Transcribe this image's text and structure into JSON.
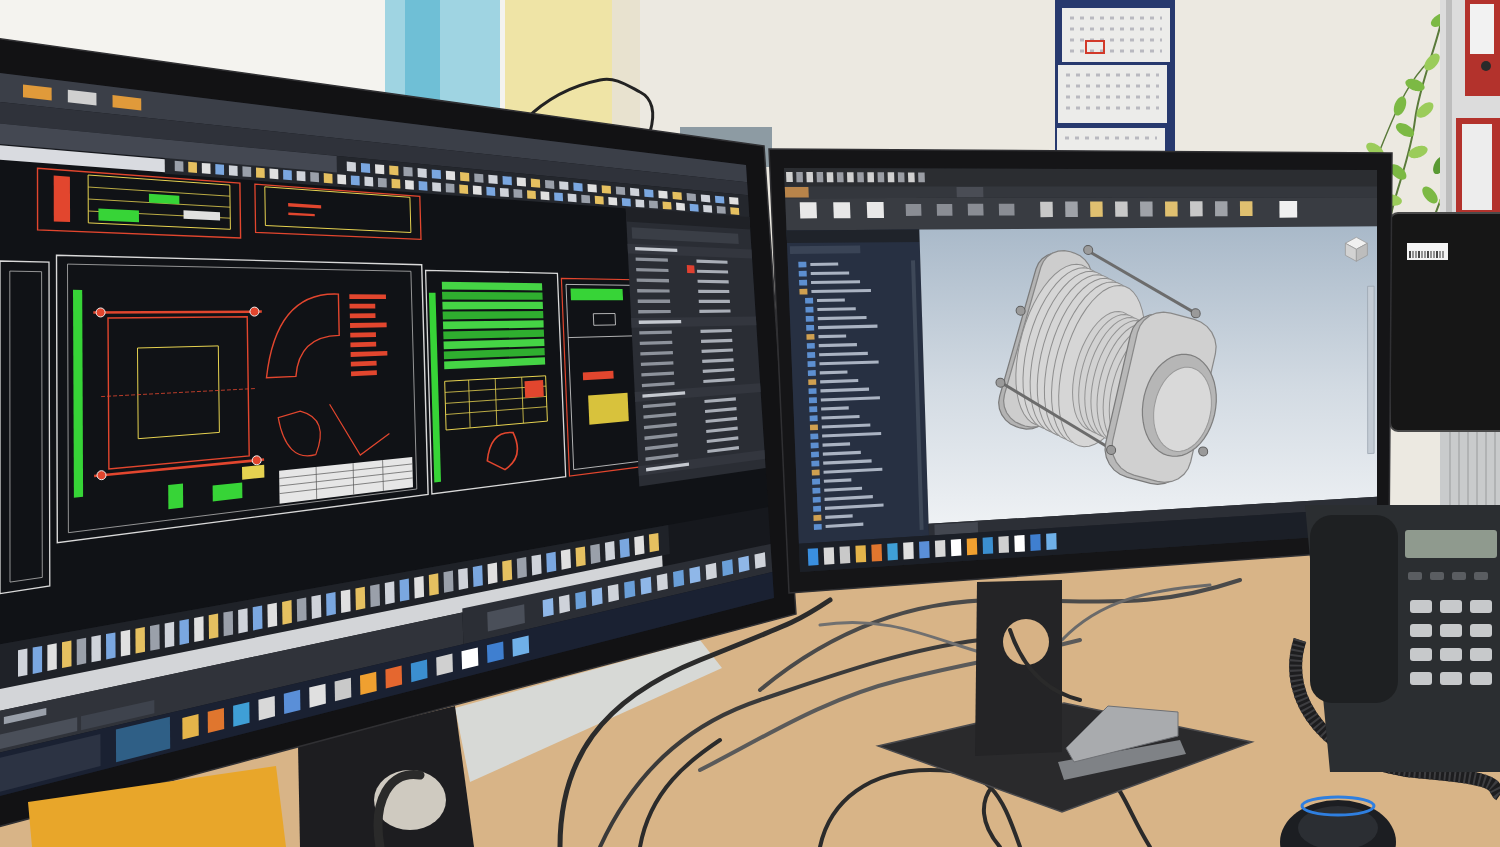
{
  "photo": {
    "objects": [
      {
        "kind": "window"
      },
      {
        "kind": "wall-picture"
      },
      {
        "kind": "wall-cable"
      },
      {
        "kind": "wall-calendar"
      },
      {
        "kind": "plant"
      },
      {
        "kind": "binder-shelf"
      },
      {
        "kind": "rear-monitor"
      },
      {
        "kind": "desk"
      },
      {
        "kind": "partition-panel"
      },
      {
        "kind": "cables"
      },
      {
        "kind": "cad-monitor"
      },
      {
        "kind": "model-monitor"
      },
      {
        "kind": "storage-box"
      },
      {
        "kind": "stapler"
      },
      {
        "kind": "desk-phone"
      },
      {
        "kind": "mouse"
      }
    ]
  }
}
